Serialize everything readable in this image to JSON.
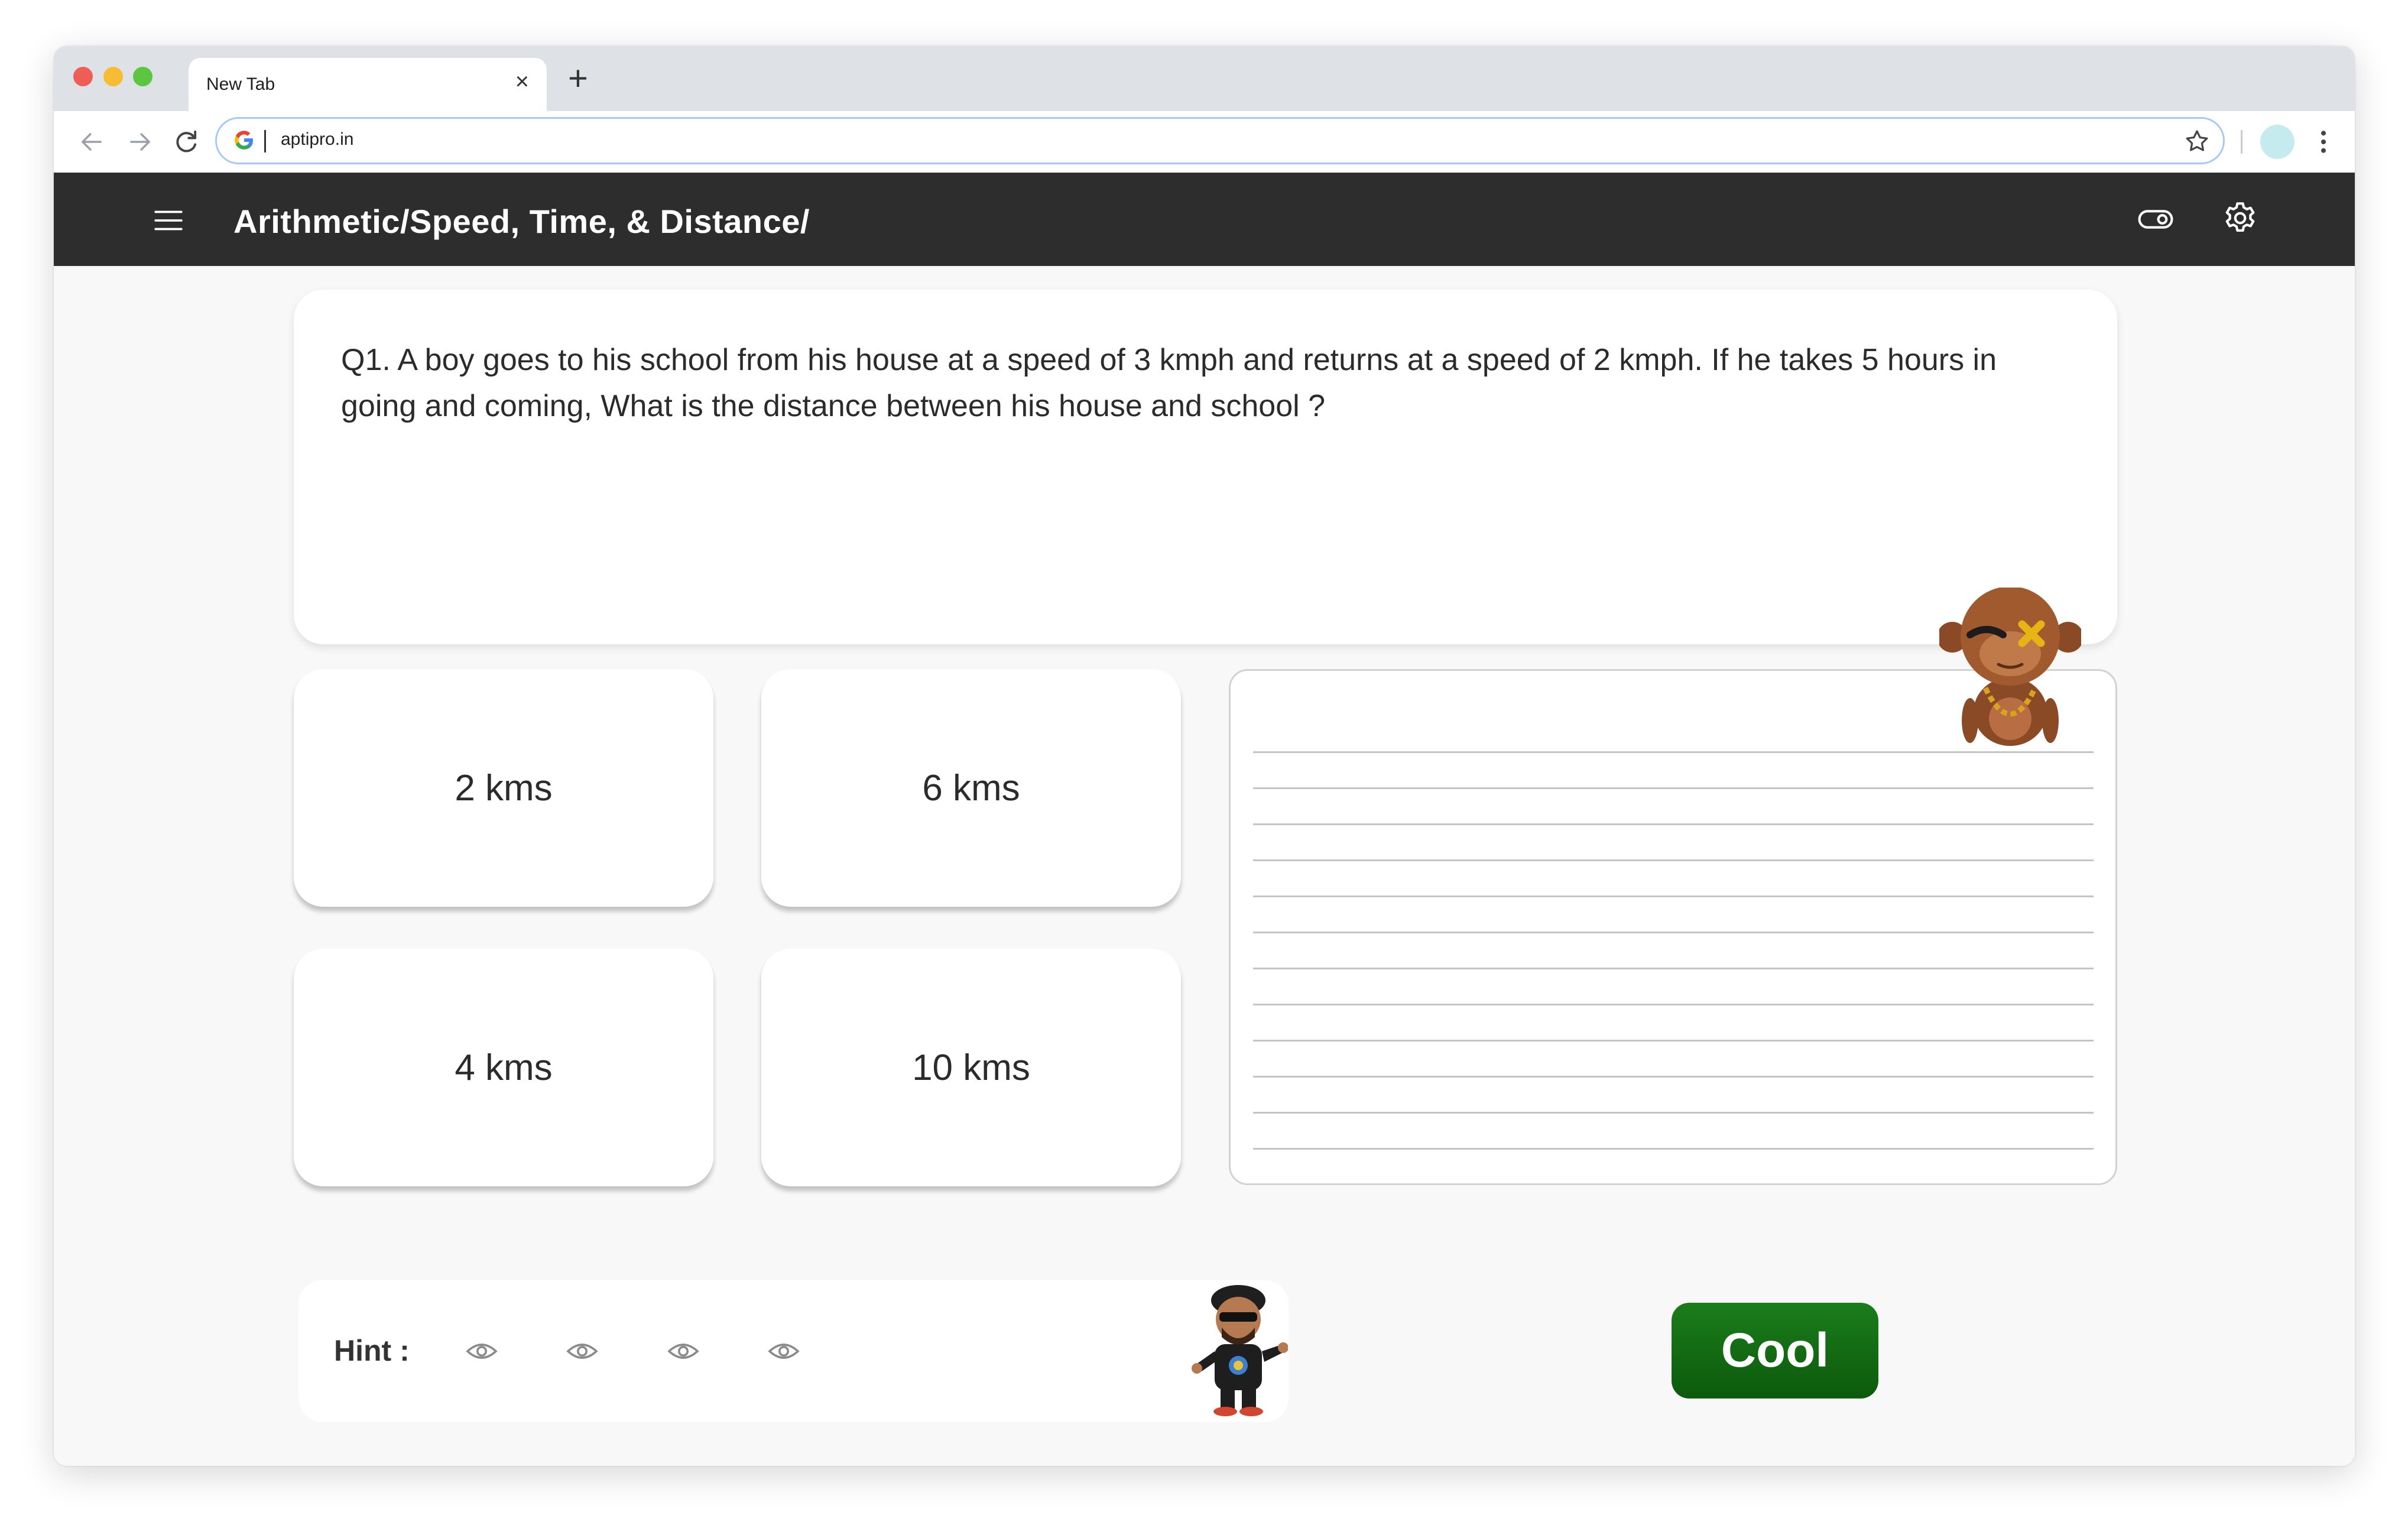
{
  "browser": {
    "tab_title": "New Tab",
    "tab_close": "×",
    "new_tab": "+",
    "url": "aptipro.in"
  },
  "header": {
    "breadcrumb": "Arithmetic/Speed, Time, & Distance/"
  },
  "question": {
    "text": "Q1. A boy goes to his school from his house at a speed of 3 kmph and returns at a speed of 2 kmph. If he takes 5 hours in going and coming, What is the distance between his house and school ?"
  },
  "options": [
    {
      "label": "2 kms"
    },
    {
      "label": "6 kms"
    },
    {
      "label": "4 kms"
    },
    {
      "label": "10 kms"
    }
  ],
  "hint": {
    "label": "Hint :"
  },
  "submit": {
    "label": "Cool"
  },
  "colors": {
    "header_bg": "#2d2d2d",
    "submit_bg": "#137013",
    "tabstrip_bg": "#dee1e6"
  }
}
